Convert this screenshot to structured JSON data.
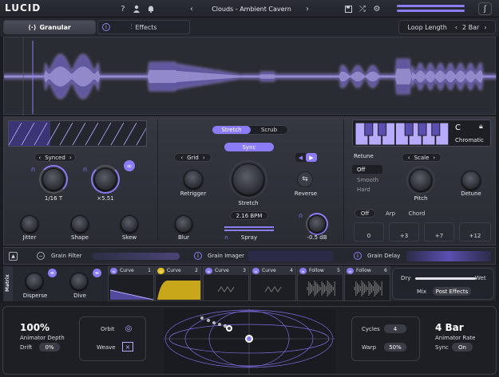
{
  "app": {
    "logo": "LUCID",
    "preset": "Clouds - Ambient Cavern",
    "help": "?"
  },
  "tabs": {
    "granular": "Granular",
    "effects": "Effects"
  },
  "loop": {
    "label": "Loop Length",
    "value": "2 Bar"
  },
  "colors": {
    "accent": "#8c7cf6",
    "panel": "#2a2c33"
  },
  "left": {
    "sync": "Synced",
    "rate_value": "1/16 T",
    "mult_value": "×5.51",
    "jitter": "Jitter",
    "shape": "Shape",
    "skew": "Skew"
  },
  "center": {
    "stretch_tab": "Stretch",
    "scrub_tab": "Scrub",
    "sync": "Sync",
    "grid": "Grid",
    "retrigger": "Retrigger",
    "stretch": "Stretch",
    "reverse": "Reverse",
    "bpm": "2.16 BPM",
    "blur": "Blur",
    "spray": "Spray",
    "gain": "-0.5 dB"
  },
  "right": {
    "key": "C",
    "scale_mode": "Chromatic",
    "retune": "Retune",
    "scale": "Scale",
    "off": "Off",
    "smooth": "Smooth",
    "hard": "Hard",
    "pitch": "Pitch",
    "detune": "Detune",
    "voice_off": "Off",
    "arp": "Arp",
    "chord": "Chord",
    "intervals": [
      "0",
      "+3",
      "+7",
      "+12"
    ]
  },
  "filters": {
    "grain_filter": "Grain Filter",
    "grain_imager": "Grain Imager",
    "grain_delay": "Grain Delay"
  },
  "matrix": {
    "label": "Matrix",
    "disperse": "Disperse",
    "dive": "Dive",
    "slots": [
      {
        "name": "Curve",
        "num": "1"
      },
      {
        "name": "Curve",
        "num": "2"
      },
      {
        "name": "Curve",
        "num": "3"
      },
      {
        "name": "Curve",
        "num": "4"
      },
      {
        "name": "Follow",
        "num": "5"
      },
      {
        "name": "Follow",
        "num": "6"
      }
    ],
    "dry": "Dry",
    "wet": "Wet",
    "mix": "Mix",
    "post": "Post Effects"
  },
  "animator": {
    "depth_value": "100%",
    "depth_label": "Animator Depth",
    "drift": "Drift",
    "drift_value": "0%",
    "orbit": "Orbit",
    "weave": "Weave",
    "cycles": "Cycles",
    "cycles_value": "4",
    "warp": "Warp",
    "warp_value": "50%",
    "rate_value": "4 Bar",
    "rate_label": "Animator Rate",
    "sync": "Sync",
    "sync_value": "On"
  }
}
